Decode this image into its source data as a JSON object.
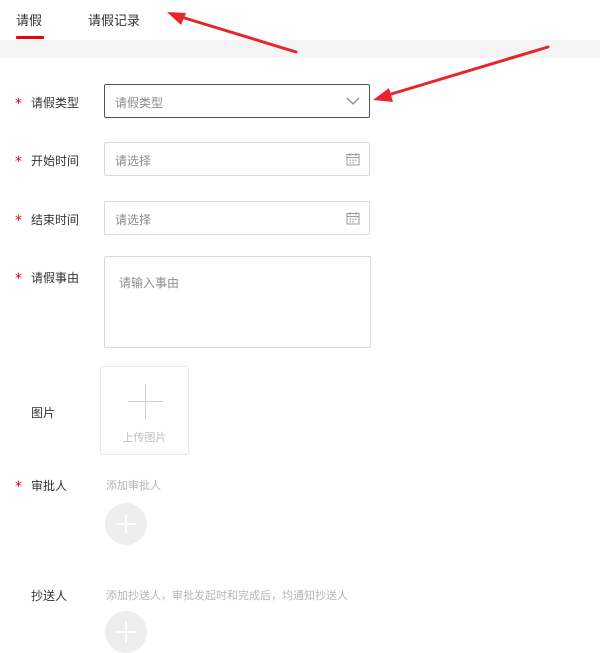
{
  "tabs": [
    {
      "label": "请假",
      "active": true
    },
    {
      "label": "请假记录",
      "active": false
    }
  ],
  "form": {
    "required_mark": "*",
    "leave_type": {
      "label": "请假类型",
      "placeholder": "请假类型",
      "icon": "chevron-down-icon"
    },
    "start_time": {
      "label": "开始时间",
      "placeholder": "请选择",
      "icon": "calendar-icon"
    },
    "end_time": {
      "label": "结束时间",
      "placeholder": "请选择",
      "icon": "calendar-icon"
    },
    "reason": {
      "label": "请假事由",
      "placeholder": "请输入事由"
    },
    "image": {
      "label": "图片",
      "upload_text": "上传图片",
      "icon": "plus-icon"
    },
    "approver": {
      "label": "审批人",
      "hint": "添加审批人",
      "icon": "plus-icon"
    },
    "cc": {
      "label": "抄送人",
      "hint": "添加抄送人，审批发起时和完成后，均通知抄送人",
      "icon": "plus-icon"
    }
  },
  "colors": {
    "accent": "#e60012",
    "annotation_arrow": "#e8252a",
    "placeholder": "#8c8c8c",
    "border": "#d9d9d9"
  }
}
